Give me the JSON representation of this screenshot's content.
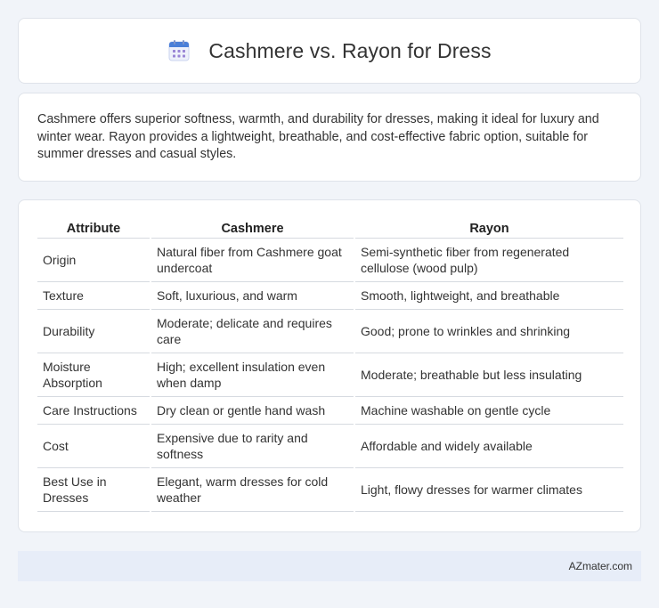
{
  "header": {
    "title": "Cashmere vs. Rayon for Dress",
    "icon": "calendar-icon",
    "accent": "#4a7fd8"
  },
  "summary": {
    "text": "Cashmere offers superior softness, warmth, and durability for dresses, making it ideal for luxury and winter wear. Rayon provides a lightweight, breathable, and cost-effective fabric option, suitable for summer dresses and casual styles."
  },
  "table": {
    "headers": [
      "Attribute",
      "Cashmere",
      "Rayon"
    ],
    "rows": [
      [
        "Origin",
        "Natural fiber from Cashmere goat undercoat",
        "Semi-synthetic fiber from regenerated cellulose (wood pulp)"
      ],
      [
        "Texture",
        "Soft, luxurious, and warm",
        "Smooth, lightweight, and breathable"
      ],
      [
        "Durability",
        "Moderate; delicate and requires care",
        "Good; prone to wrinkles and shrinking"
      ],
      [
        "Moisture Absorption",
        "High; excellent insulation even when damp",
        "Moderate; breathable but less insulating"
      ],
      [
        "Care Instructions",
        "Dry clean or gentle hand wash",
        "Machine washable on gentle cycle"
      ],
      [
        "Cost",
        "Expensive due to rarity and softness",
        "Affordable and widely available"
      ],
      [
        "Best Use in Dresses",
        "Elegant, warm dresses for cold weather",
        "Light, flowy dresses for warmer climates"
      ]
    ]
  },
  "footer": {
    "brand": "AZmater.com"
  }
}
